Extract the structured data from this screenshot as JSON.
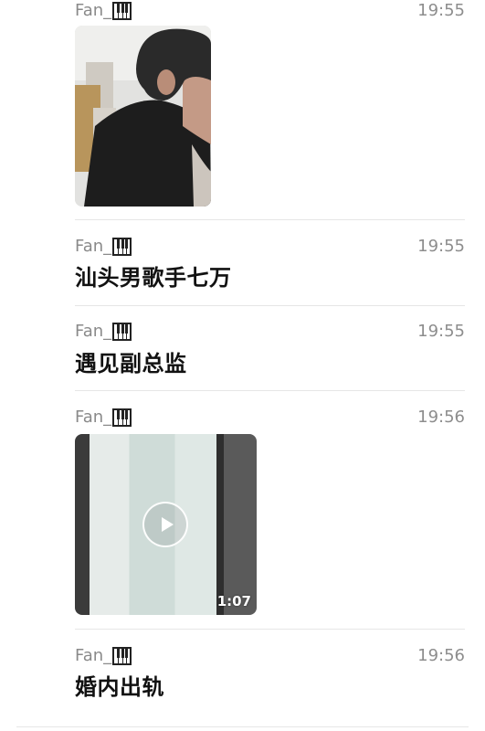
{
  "messages": [
    {
      "sender": "Fan_",
      "time": "19:55",
      "type": "image"
    },
    {
      "sender": "Fan_",
      "time": "19:55",
      "type": "text",
      "text": "汕头男歌手七万"
    },
    {
      "sender": "Fan_",
      "time": "19:55",
      "type": "text",
      "text": "遇见副总监"
    },
    {
      "sender": "Fan_",
      "time": "19:56",
      "type": "video",
      "duration": "1:07"
    },
    {
      "sender": "Fan_",
      "time": "19:56",
      "type": "text",
      "text": "婚内出轨"
    }
  ],
  "icons": {
    "sender_badge": "piano-keys-icon",
    "video_overlay": "play-icon"
  }
}
